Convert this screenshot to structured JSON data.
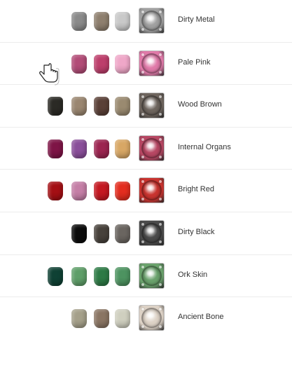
{
  "rows": [
    {
      "name": "Dirty Metal",
      "pots": [
        "",
        "#8a8a8a",
        "#8e7f6e",
        "#c9c9c9"
      ],
      "thumb": "#a0a0a0"
    },
    {
      "name": "Pale Pink",
      "pots": [
        "",
        "#b24c77",
        "#bd3e6b",
        "#efa7c8"
      ],
      "thumb": "#e07aa9"
    },
    {
      "name": "Wood Brown",
      "pots": [
        "#2b2a25",
        "#9a8670",
        "#5a4037",
        "#9a8a70"
      ],
      "thumb": "#6e655e"
    },
    {
      "name": "Internal Organs",
      "pots": [
        "#7e1446",
        "#8a4f9a",
        "#9c2450",
        "#d8a765"
      ],
      "thumb": "#b74763"
    },
    {
      "name": "Bright Red",
      "pots": [
        "#a40f14",
        "#c47ea6",
        "#c41821",
        "#e32d1f"
      ],
      "thumb": "#c8332f"
    },
    {
      "name": "Dirty Black",
      "pots": [
        "",
        "#0b0b0b",
        "#47413b",
        "#6a6560"
      ],
      "thumb": "#4a4a4a"
    },
    {
      "name": "Ork Skin",
      "pots": [
        "#0f4134",
        "#5e9e68",
        "#2d7a45",
        "#4d9360"
      ],
      "thumb": "#6aa26c"
    },
    {
      "name": "Ancient Bone",
      "pots": [
        "",
        "#a5a08a",
        "#8a7563",
        "#cfcfbf"
      ],
      "thumb": "#ddd2c6"
    }
  ]
}
